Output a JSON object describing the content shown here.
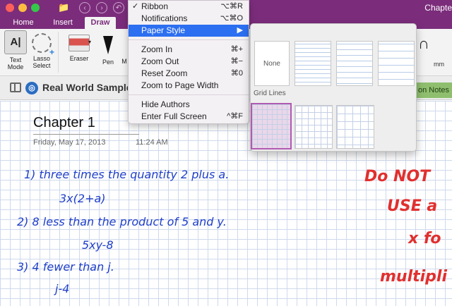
{
  "window": {
    "title_fragment": "Chapte",
    "tabs": [
      "Home",
      "Insert",
      "Draw"
    ],
    "active_tab": "Draw"
  },
  "ribbon": {
    "text_mode": "Text\nMode",
    "text_mode_l1": "Text",
    "text_mode_l2": "Mode",
    "lasso_l1": "Lasso",
    "lasso_l2": "Select",
    "eraser": "Eraser",
    "pen": "Pen",
    "m_fragment": "M",
    "mm_left": "mm",
    "mm_right": "mm",
    "text_mode_icon": "A|"
  },
  "notebook": {
    "name": "Real World Samples",
    "section_tab": "on Notes"
  },
  "view_menu": {
    "items": [
      {
        "label": "Ribbon",
        "shortcut": "⌥⌘R",
        "checked": "✓"
      },
      {
        "label": "Notifications",
        "shortcut": "⌥⌘O"
      },
      {
        "label": "Paper Style",
        "shortcut": "▶"
      },
      {
        "label": "Zoom In",
        "shortcut": "⌘+"
      },
      {
        "label": "Zoom Out",
        "shortcut": "⌘−"
      },
      {
        "label": "Reset Zoom",
        "shortcut": "⌘0"
      },
      {
        "label": "Zoom to Page Width",
        "shortcut": ""
      },
      {
        "label": "Hide Authors",
        "shortcut": ""
      },
      {
        "label": "Enter Full Screen",
        "shortcut": "^⌘F"
      }
    ]
  },
  "paper_style": {
    "none_label": "None",
    "grid_lines_label": "Grid Lines"
  },
  "page": {
    "title": "Chapter 1",
    "date": "Friday, May 17, 2013",
    "time": "11:24 AM",
    "ink": [
      "1) three times the quantity 2 plus a.",
      "3x(2+a)",
      "2) 8 less than the product of 5 and y.",
      "5xy-8",
      "3) 4 fewer than j.",
      "j-4"
    ],
    "red_ink": [
      "Do NOT",
      "USE a",
      "x fo",
      "multipli"
    ]
  }
}
